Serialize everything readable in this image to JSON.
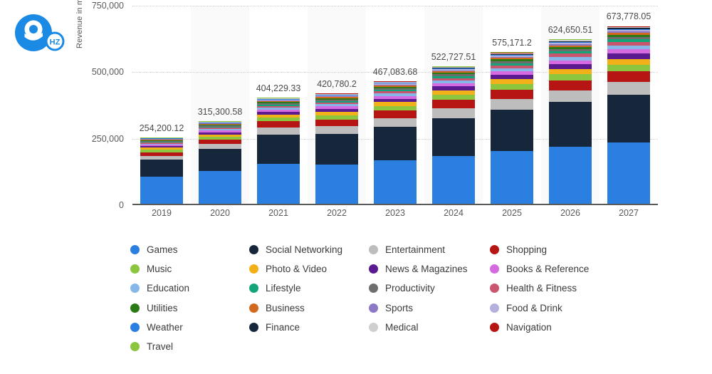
{
  "logo": {
    "mark": "9",
    "badge": "HZ",
    "color": "#1a8ae5"
  },
  "chart_data": {
    "type": "bar",
    "stacked": true,
    "title": "",
    "subtitle": "",
    "xlabel": "",
    "ylabel": "Revenue in million U.S. dollars",
    "ylim": [
      0,
      750000
    ],
    "yticks": [
      0,
      250000,
      500000,
      750000
    ],
    "ytick_labels": [
      "0",
      "250,000",
      "500,000",
      "750,000"
    ],
    "grid": true,
    "legend_position": "bottom",
    "categories": [
      "2019",
      "2020",
      "2021",
      "2022",
      "2023",
      "2024",
      "2025",
      "2026",
      "2027"
    ],
    "totals": [
      254200.12,
      315300.58,
      404229.33,
      420780.2,
      467083.68,
      522727.51,
      575171.2,
      624650.51,
      673778.05
    ],
    "total_labels": [
      "254,200.12",
      "315,300.58",
      "404,229.33",
      "420,780.2",
      "467,083.68",
      "522,727.51",
      "575,171.2",
      "624,650.51",
      "673,778.05"
    ],
    "series": [
      {
        "name": "Games",
        "color": "#2b7fe0",
        "values": [
          107000,
          133000,
          160000,
          155000,
          172000,
          190000,
          213000,
          232000,
          250000
        ]
      },
      {
        "name": "Social Networking",
        "color": "#16263b",
        "values": [
          65000,
          85000,
          112000,
          116000,
          131000,
          148000,
          163000,
          177000,
          190000
        ]
      },
      {
        "name": "Entertainment",
        "color": "#bdbdbd",
        "values": [
          15000,
          20000,
          27000,
          29000,
          33000,
          38000,
          42000,
          46000,
          50000
        ]
      },
      {
        "name": "Shopping",
        "color": "#b71414",
        "values": [
          13000,
          17000,
          23000,
          25000,
          28000,
          32000,
          36000,
          40000,
          44000
        ]
      },
      {
        "name": "Music",
        "color": "#8cc63e",
        "values": [
          9000,
          11000,
          14000,
          15000,
          17000,
          19000,
          21000,
          23000,
          25000
        ]
      },
      {
        "name": "Photo & Video",
        "color": "#f2b118",
        "values": [
          8000,
          10000,
          13000,
          14000,
          16000,
          18000,
          20000,
          22000,
          24000
        ]
      },
      {
        "name": "News & Magazines",
        "color": "#5b1a8f",
        "values": [
          6000,
          8000,
          10000,
          11000,
          13000,
          15000,
          17000,
          19000,
          21000
        ]
      },
      {
        "name": "Books & Reference",
        "color": "#d66ae0",
        "values": [
          5000,
          6500,
          8500,
          9000,
          10500,
          12000,
          13500,
          15000,
          16500
        ]
      },
      {
        "name": "Education",
        "color": "#85b7e8",
        "values": [
          4500,
          6000,
          7500,
          8000,
          9500,
          11000,
          12500,
          14000,
          15500
        ]
      },
      {
        "name": "Health & Fitness",
        "color": "#c9566e",
        "values": [
          4000,
          5000,
          6500,
          7000,
          8000,
          9500,
          11000,
          12000,
          13500
        ]
      },
      {
        "name": "Lifestyle",
        "color": "#12a57a",
        "values": [
          3500,
          4500,
          5500,
          6000,
          7000,
          8000,
          9000,
          10000,
          11000
        ]
      },
      {
        "name": "Productivity",
        "color": "#6e6e6e",
        "values": [
          3000,
          4000,
          5000,
          5500,
          6500,
          7000,
          8000,
          9000,
          10000
        ]
      },
      {
        "name": "Utilities",
        "color": "#2c7a15",
        "values": [
          2500,
          3200,
          4200,
          4500,
          5200,
          6000,
          6800,
          7500,
          8200
        ]
      },
      {
        "name": "Business",
        "color": "#d2691e",
        "values": [
          2000,
          2800,
          3600,
          3900,
          4500,
          5200,
          5800,
          6500,
          7200
        ]
      },
      {
        "name": "Sports",
        "color": "#8c78c4",
        "values": [
          1800,
          2400,
          3100,
          3300,
          3900,
          4400,
          5000,
          5600,
          6200
        ]
      },
      {
        "name": "Food & Drink",
        "color": "#b3b0de",
        "values": [
          1500,
          2000,
          2600,
          2800,
          3300,
          3800,
          4300,
          4800,
          5300
        ]
      },
      {
        "name": "Weather",
        "color": "#2b7fe0",
        "values": [
          1200,
          1600,
          2100,
          2300,
          2700,
          3100,
          3500,
          3900,
          4300
        ]
      },
      {
        "name": "Finance",
        "color": "#16263b",
        "values": [
          1000,
          1400,
          1800,
          2000,
          2300,
          2700,
          3000,
          3400,
          3700
        ]
      },
      {
        "name": "Medical",
        "color": "#cfcfcf",
        "values": [
          900,
          1200,
          1500,
          1700,
          2000,
          2300,
          2600,
          2900,
          3200
        ]
      },
      {
        "name": "Navigation",
        "color": "#b71414",
        "values": [
          800,
          1000,
          1300,
          1400,
          1700,
          1900,
          2200,
          2400,
          2700
        ]
      },
      {
        "name": "Travel",
        "color": "#8cc63e",
        "values": [
          700,
          900,
          1100,
          1200,
          1400,
          1600,
          1800,
          2000,
          2200
        ]
      }
    ]
  },
  "legend": {
    "columns": [
      [
        {
          "label": "Games",
          "color": "#2b7fe0"
        },
        {
          "label": "Music",
          "color": "#8cc63e"
        },
        {
          "label": "Education",
          "color": "#85b7e8"
        },
        {
          "label": "Utilities",
          "color": "#2c7a15"
        },
        {
          "label": "Weather",
          "color": "#2b7fe0"
        },
        {
          "label": "Travel",
          "color": "#8cc63e"
        }
      ],
      [
        {
          "label": "Social Networking",
          "color": "#16263b"
        },
        {
          "label": "Photo & Video",
          "color": "#f2b118"
        },
        {
          "label": "Lifestyle",
          "color": "#12a57a"
        },
        {
          "label": "Business",
          "color": "#d2691e"
        },
        {
          "label": "Finance",
          "color": "#16263b"
        }
      ],
      [
        {
          "label": "Entertainment",
          "color": "#bdbdbd"
        },
        {
          "label": "News & Magazines",
          "color": "#5b1a8f"
        },
        {
          "label": "Productivity",
          "color": "#6e6e6e"
        },
        {
          "label": "Sports",
          "color": "#8c78c4"
        },
        {
          "label": "Medical",
          "color": "#cfcfcf"
        }
      ],
      [
        {
          "label": "Shopping",
          "color": "#b71414"
        },
        {
          "label": "Books & Reference",
          "color": "#d66ae0"
        },
        {
          "label": "Health & Fitness",
          "color": "#c9566e"
        },
        {
          "label": "Food & Drink",
          "color": "#b3b0de"
        },
        {
          "label": "Navigation",
          "color": "#b71414"
        }
      ]
    ]
  }
}
